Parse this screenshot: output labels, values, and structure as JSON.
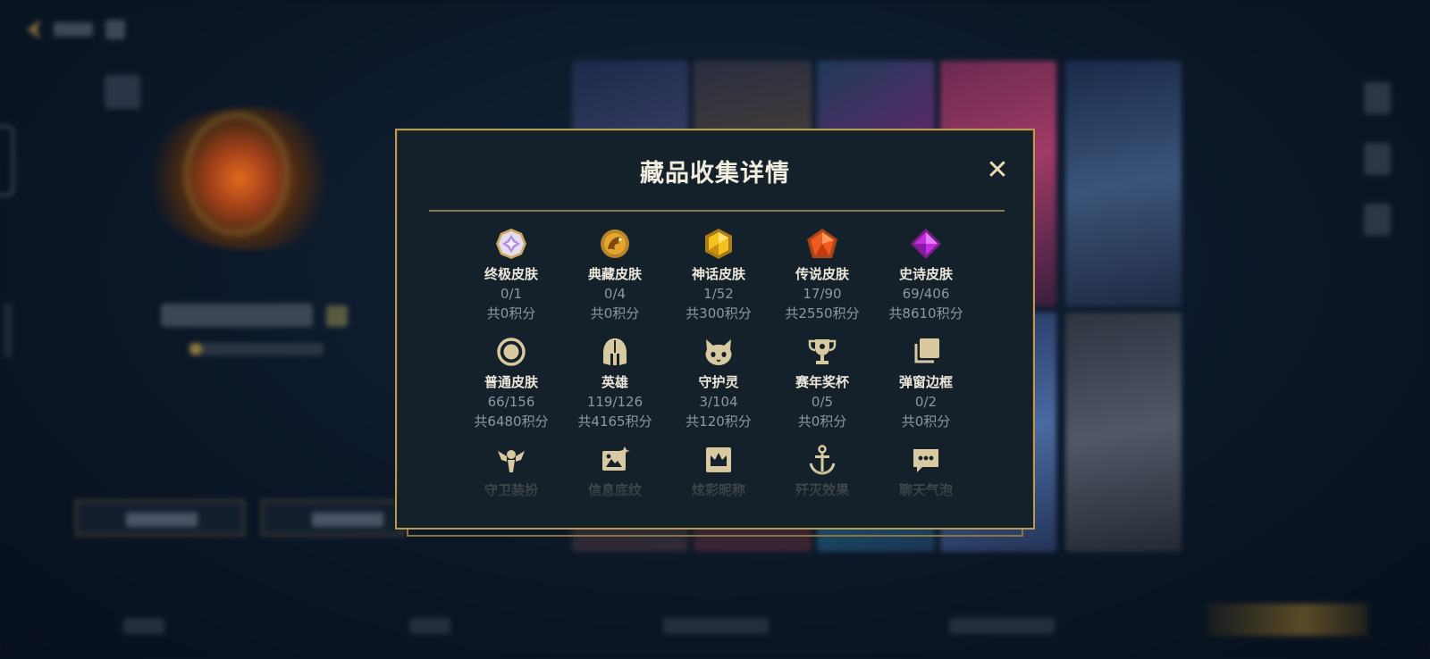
{
  "modal": {
    "title": "藏品收集详情",
    "close_label": "✕"
  },
  "categories": [
    {
      "label": "终极皮肤",
      "count": "0/1",
      "points": "共0积分",
      "icon": "ultimate-skin-gem-icon"
    },
    {
      "label": "典藏皮肤",
      "count": "0/4",
      "points": "共0积分",
      "icon": "collector-skin-dragon-icon"
    },
    {
      "label": "神话皮肤",
      "count": "1/52",
      "points": "共300积分",
      "icon": "mythic-skin-gem-icon"
    },
    {
      "label": "传说皮肤",
      "count": "17/90",
      "points": "共2550积分",
      "icon": "legendary-skin-gem-icon"
    },
    {
      "label": "史诗皮肤",
      "count": "69/406",
      "points": "共8610积分",
      "icon": "epic-skin-gem-icon"
    },
    {
      "label": "普通皮肤",
      "count": "66/156",
      "points": "共6480积分",
      "icon": "normal-skin-circle-icon"
    },
    {
      "label": "英雄",
      "count": "119/126",
      "points": "共4165积分",
      "icon": "hero-helmet-icon"
    },
    {
      "label": "守护灵",
      "count": "3/104",
      "points": "共120积分",
      "icon": "guardian-pet-icon"
    },
    {
      "label": "赛年奖杯",
      "count": "0/5",
      "points": "共0积分",
      "icon": "season-trophy-icon"
    },
    {
      "label": "弹窗边框",
      "count": "0/2",
      "points": "共0积分",
      "icon": "popup-frame-icon"
    },
    {
      "label": "守卫装扮",
      "icon": "ward-skin-icon"
    },
    {
      "label": "信息底纹",
      "icon": "info-card-icon"
    },
    {
      "label": "炫彩昵称",
      "icon": "colorful-nickname-icon"
    },
    {
      "label": "歼灭效果",
      "icon": "ace-effect-icon"
    },
    {
      "label": "聊天气泡",
      "icon": "chat-bubble-icon"
    }
  ],
  "colors": {
    "modal_border": "#b89a52",
    "modal_bg": "#14212a",
    "title": "#f0ecde",
    "muted": "#8f979e",
    "gold": "#c9a860"
  }
}
